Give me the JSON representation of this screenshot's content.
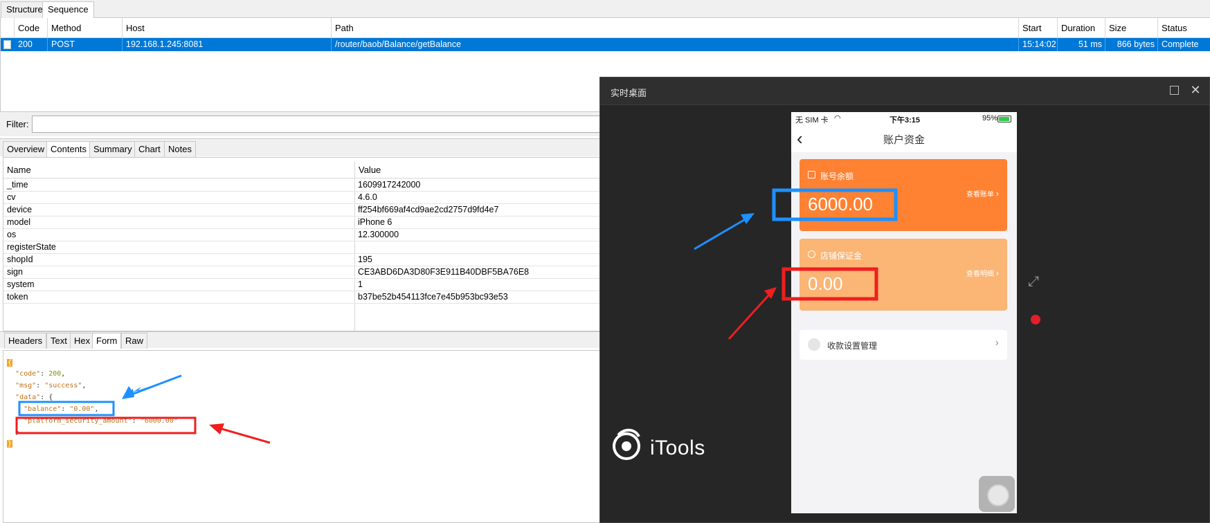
{
  "main_tabs": [
    "Structure",
    "Sequence"
  ],
  "sequence": {
    "columns": [
      "Code",
      "Method",
      "Host",
      "Path",
      "Start",
      "Duration",
      "Size",
      "Status"
    ],
    "row": {
      "code": "200",
      "method": "POST",
      "host": "192.168.1.245:8081",
      "path": "/router/baob/Balance/getBalance",
      "start": "15:14:02",
      "duration": "51 ms",
      "size": "866 bytes",
      "status": "Complete"
    }
  },
  "filter": {
    "label": "Filter:",
    "value": ""
  },
  "detail_tabs": [
    "Overview",
    "Contents",
    "Summary",
    "Chart",
    "Notes"
  ],
  "form": {
    "headers": [
      "Name",
      "Value"
    ],
    "rows": [
      {
        "name": "_time",
        "value": "1609917242000"
      },
      {
        "name": "cv",
        "value": "4.6.0"
      },
      {
        "name": "device",
        "value": "ff254bf669af4cd9ae2cd2757d9fd4e7"
      },
      {
        "name": "model",
        "value": "iPhone 6"
      },
      {
        "name": "os",
        "value": "12.300000"
      },
      {
        "name": "registerState",
        "value": ""
      },
      {
        "name": "shopId",
        "value": "195"
      },
      {
        "name": "sign",
        "value": "CE3ABD6DA3D80F3E911B40DBF5BA76E8"
      },
      {
        "name": "system",
        "value": "1"
      },
      {
        "name": "token",
        "value": "b37be52b454113fce7e45b953bc93e53"
      }
    ]
  },
  "response_tabs": [
    "Headers",
    "Text",
    "Hex",
    "Form",
    "Raw"
  ],
  "json": {
    "open": "{",
    "code_key": "\"code\"",
    "code_val": "200",
    "msg_key": "\"msg\"",
    "msg_val": "\"success\"",
    "data_key": "\"data\"",
    "balance_key": "\"balance\"",
    "balance_val": "\"0.00\"",
    "psa_key": "\"platform_security_amount\"",
    "psa_val": "\"6000.00\"",
    "inner_close": "}",
    "close": "}"
  },
  "itools": {
    "title": "实时桌面",
    "logo_text": "iTools",
    "phone": {
      "carrier": "无 SIM 卡",
      "time": "下午3:15",
      "battery": "95%",
      "battery_level": 0.95,
      "nav_title": "账户资金",
      "balance_label": "账号余额",
      "balance_amount": "6000.00",
      "balance_link": "查看账单",
      "deposit_label": "店铺保证金",
      "deposit_amount": "0.00",
      "deposit_link": "查看明细",
      "collect_label": "收款设置管理"
    }
  },
  "colors": {
    "selection": "#0078d7",
    "card_balance": "#ff8132",
    "card_deposit": "#fbb574",
    "annotation_blue": "#1e90ff",
    "annotation_red": "#f01e1e"
  }
}
